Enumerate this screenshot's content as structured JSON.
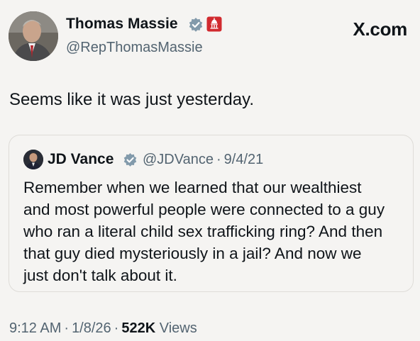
{
  "author": {
    "name": "Thomas Massie",
    "handle": "@RepThomasMassie",
    "verified_color": "#829aab",
    "gov_badge_color": "#d12a2f"
  },
  "site_label": "X.com",
  "tweet": {
    "text": "Seems like it was just yesterday."
  },
  "quoted": {
    "name": "JD Vance",
    "handle": "@JDVance",
    "date": "9/4/21",
    "lines": [
      "Remember when we learned that our wealthiest",
      "and most powerful people were connected to a guy",
      "who ran a literal child sex trafficking ring? And then",
      "that guy died mysteriously in a jail? And now we",
      "just don't talk about it."
    ]
  },
  "footer": {
    "time": "9:12 AM",
    "date": "1/8/26",
    "views_count": "522K",
    "views_label": "Views"
  }
}
